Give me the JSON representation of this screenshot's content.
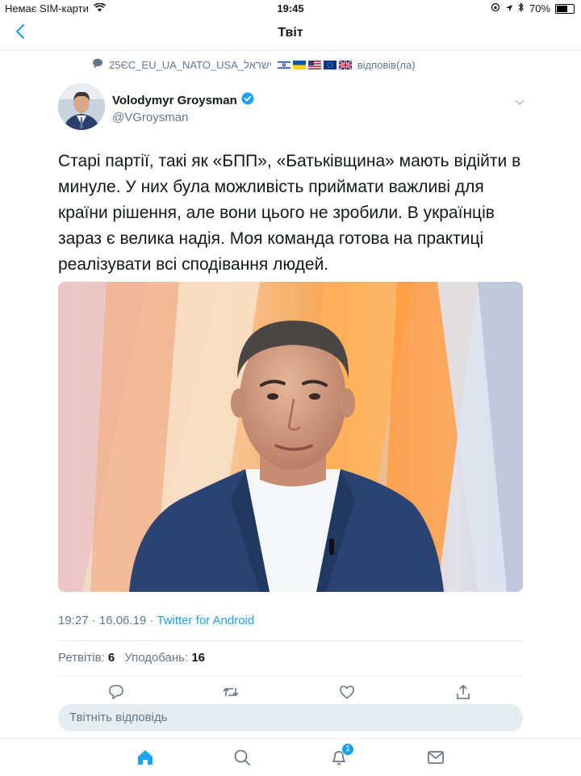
{
  "status_bar": {
    "carrier": "Немає SIM-карти",
    "time": "19:45",
    "battery": "70%",
    "battery_level": 0.7
  },
  "nav": {
    "title": "Твіт",
    "back_icon": "chevron-left-icon"
  },
  "reply_context": {
    "prefix": "25ЄС_EU_UA_NATO_USA_ישראל",
    "suffix": "відповів(ла)",
    "flags": [
      "israel-flag",
      "ukraine-flag",
      "usa-flag",
      "eu-flag",
      "uk-flag"
    ]
  },
  "author": {
    "name": "Volodymyr Groysman",
    "handle": "@VGroysman",
    "verified": true
  },
  "tweet": {
    "text": "Старі партії, такі як «БПП», «Батьківщина» мають відійти в минуле. У них була можливість приймати важливі для країни рішення, але вони цього не зробили. В українців зараз є велика надія. Моя команда готова на практиці реалізувати всі сподівання людей.",
    "time": "19:27 · 16.06.19 · ",
    "source": "Twitter for Android"
  },
  "stats": {
    "retweets_label": "Ретвітів:",
    "retweets": "6",
    "likes_label": "Уподобань:",
    "likes": "16"
  },
  "reply_box": {
    "placeholder": "Твітніть відповідь"
  },
  "tab_bar": {
    "notifications_badge": "1"
  },
  "colors": {
    "accent": "#1da1f2",
    "secondary_text": "#657786",
    "divider": "#e6ecf0"
  }
}
